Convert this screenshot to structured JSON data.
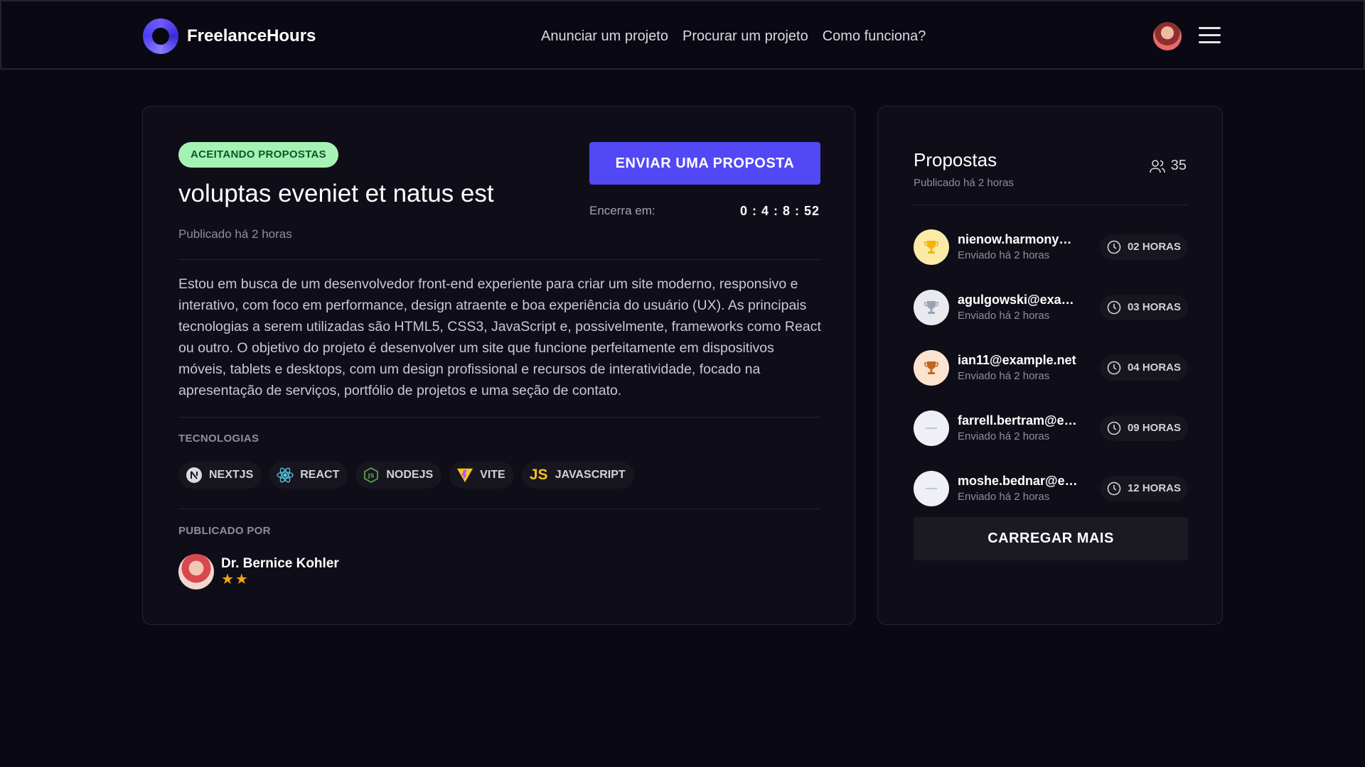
{
  "header": {
    "brand": "FreelanceHours",
    "nav": [
      "Anunciar um projeto",
      "Procurar um projeto",
      "Como funciona?"
    ]
  },
  "project": {
    "status": "ACEITANDO PROPOSTAS",
    "title": "voluptas eveniet et natus est",
    "published": "Publicado há 2 horas",
    "send_button": "ENVIAR UMA PROPOSTA",
    "ends_label": "Encerra em:",
    "countdown": "0 : 4 : 8 : 52",
    "description": "Estou em busca de um desenvolvedor front-end experiente para criar um site moderno, responsivo e interativo, com foco em performance, design atraente e boa experiência do usuário (UX). As principais tecnologias a serem utilizadas são HTML5, CSS3, JavaScript e, possivelmente, frameworks como React ou outro. O objetivo do projeto é desenvolver um site que funcione perfeitamente em dispositivos móveis, tablets e desktops, com um design profissional e recursos de interatividade, focado na apresentação de serviços, portfólio de projetos e uma seção de contato.",
    "tech_label": "TECNOLOGIAS",
    "techs": [
      {
        "label": "NEXTJS",
        "icon": "nextjs-icon"
      },
      {
        "label": "REACT",
        "icon": "react-icon"
      },
      {
        "label": "NODEJS",
        "icon": "nodejs-icon"
      },
      {
        "label": "VITE",
        "icon": "vite-icon"
      },
      {
        "label": "JAVASCRIPT",
        "icon": "javascript-icon",
        "icon_text": "JS"
      }
    ],
    "published_by_label": "PUBLICADO POR",
    "author": {
      "name": "Dr. Bernice Kohler",
      "stars": "★★"
    }
  },
  "proposals": {
    "title": "Propostas",
    "published": "Publicado há 2 horas",
    "count": "35",
    "items": [
      {
        "email": "nienow.harmony@example.com",
        "sent": "Enviado há 2 horas",
        "hours": "02 HORAS",
        "medal": "gold"
      },
      {
        "email": "agulgowski@example.com",
        "sent": "Enviado há 2 horas",
        "hours": "03 HORAS",
        "medal": "silver"
      },
      {
        "email": "ian11@example.net",
        "sent": "Enviado há 2 horas",
        "hours": "04 HORAS",
        "medal": "bronze"
      },
      {
        "email": "farrell.bertram@example.com",
        "sent": "Enviado há 2 horas",
        "hours": "09 HORAS",
        "medal": "none"
      },
      {
        "email": "moshe.bednar@example.com",
        "sent": "Enviado há 2 horas",
        "hours": "12 HORAS",
        "medal": "none"
      }
    ],
    "load_more": "CARREGAR MAIS"
  },
  "colors": {
    "accent": "#5348f5",
    "background": "#0a0913",
    "card": "#0f0e18",
    "status_badge": "#a5f3b4",
    "star": "#f4a814"
  }
}
